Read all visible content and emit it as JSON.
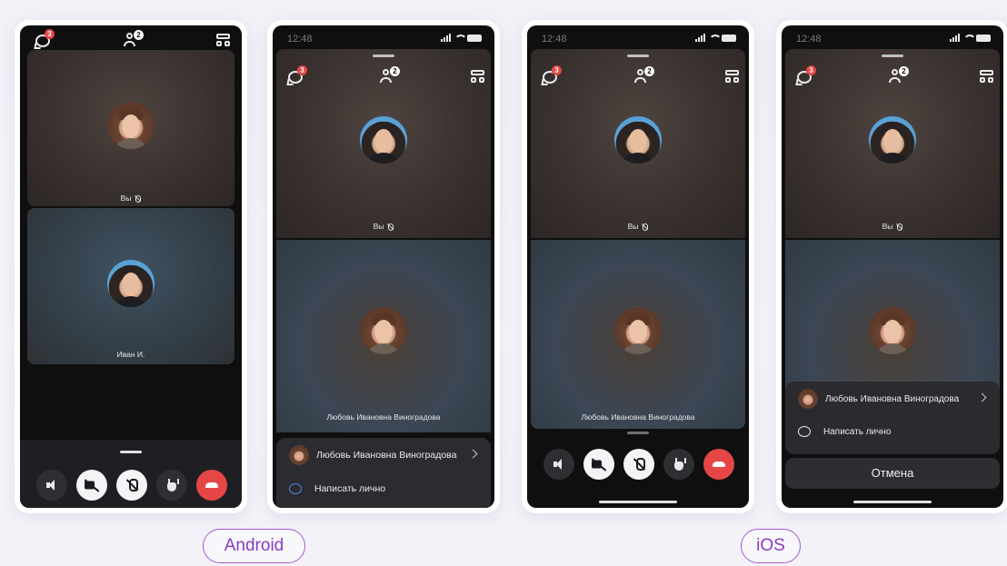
{
  "platforms": {
    "android": "Android",
    "ios": "iOS"
  },
  "status": {
    "time": "12:48"
  },
  "topbar": {
    "chat_badge": "3",
    "participants_badge": "2"
  },
  "tiles": {
    "you_label": "Вы",
    "ivan_label": "Иван И.",
    "lyubov_label": "Любовь Ивановна Виноградова"
  },
  "sheet": {
    "participant_name": "Любовь Ивановна Виноградова",
    "write_privately": "Написать лично",
    "cancel": "Отмена"
  },
  "icons": {
    "chat": "chat-bubble-icon",
    "participants": "people-icon",
    "layout": "layout-grid-icon",
    "speaker": "speaker-icon",
    "camera_off": "camera-off-icon",
    "mic_off": "mic-off-icon",
    "raise_hand": "hand-icon",
    "hang_up": "hang-up-icon"
  },
  "colors": {
    "hang_up": "#e64646",
    "badge": "#e64646",
    "accent_platform": "#8a3cc4",
    "message_icon": "#4b89e6"
  }
}
